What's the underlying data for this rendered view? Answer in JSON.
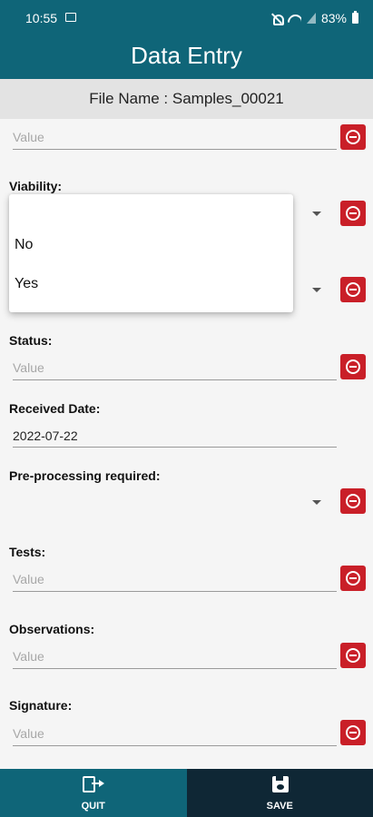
{
  "status_bar": {
    "time": "10:55",
    "battery": "83%"
  },
  "app": {
    "title": "Data Entry"
  },
  "file": {
    "name": "File Name : Samples_00021"
  },
  "fields": {
    "top_placeholder": "Value",
    "viability_label": "Viability:",
    "status_label": "Status:",
    "status_placeholder": "Value",
    "received_date_label": "Received Date:",
    "received_date_value": "2022-07-22",
    "preprocessing_label": "Pre-processing required:",
    "tests_label": "Tests:",
    "tests_placeholder": "Value",
    "observations_label": "Observations:",
    "observations_placeholder": "Value",
    "signature_label": "Signature:",
    "signature_placeholder": "Value"
  },
  "popup": {
    "options": [
      "No",
      "Yes"
    ]
  },
  "bottom": {
    "quit_label": "QUIT",
    "save_label": "SAVE"
  },
  "colors": {
    "appbar": "#0f6578",
    "remove": "#c91f28",
    "save_bg": "#0f2735"
  }
}
